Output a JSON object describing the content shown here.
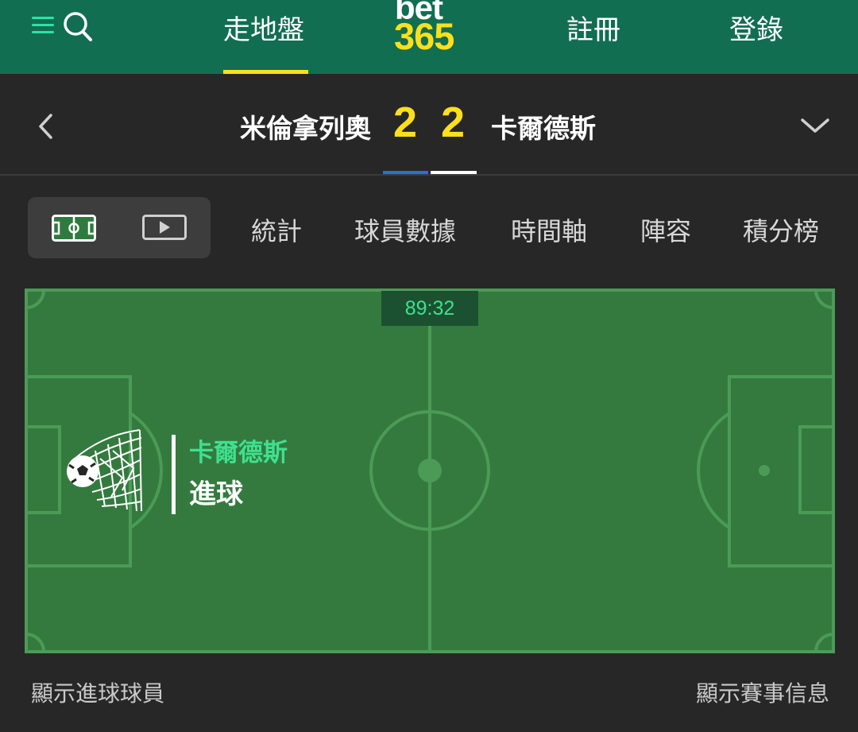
{
  "header": {
    "menu_icon": "menu-icon",
    "search_icon": "search-icon",
    "nav": {
      "inplay": "走地盤",
      "register": "註冊",
      "login": "登錄"
    },
    "logo": {
      "top": "bet",
      "bottom": "365"
    },
    "colors": {
      "background": "#126e51",
      "accent": "#ffdf1b",
      "icon": "#25e7a5"
    }
  },
  "scoreboard": {
    "home_team": "米倫拿列奧",
    "home_score": "2",
    "away_score": "2",
    "away_team": "卡爾德斯",
    "back_icon": "chevron-left-icon",
    "expand_icon": "chevron-down-icon",
    "colors": {
      "score": "#ffdf1b",
      "home_kit": "#2b6fd1",
      "away_kit": "#ffffff"
    }
  },
  "tabs": {
    "view_icons": [
      "pitch-icon",
      "play-video-icon"
    ],
    "items": [
      {
        "label": "統計"
      },
      {
        "label": "球員數據"
      },
      {
        "label": "時間軸"
      },
      {
        "label": "陣容"
      },
      {
        "label": "積分榜"
      }
    ]
  },
  "match": {
    "clock": "89:32",
    "event": {
      "icon": "goal-net-icon",
      "team": "卡爾德斯",
      "type": "進球"
    },
    "colors": {
      "pitch": "#347a3f",
      "lines": "#4b9b56",
      "event_team": "#3fe08f"
    }
  },
  "footer": {
    "show_scorers": "顯示進球球員",
    "show_match_info": "顯示賽事信息"
  }
}
